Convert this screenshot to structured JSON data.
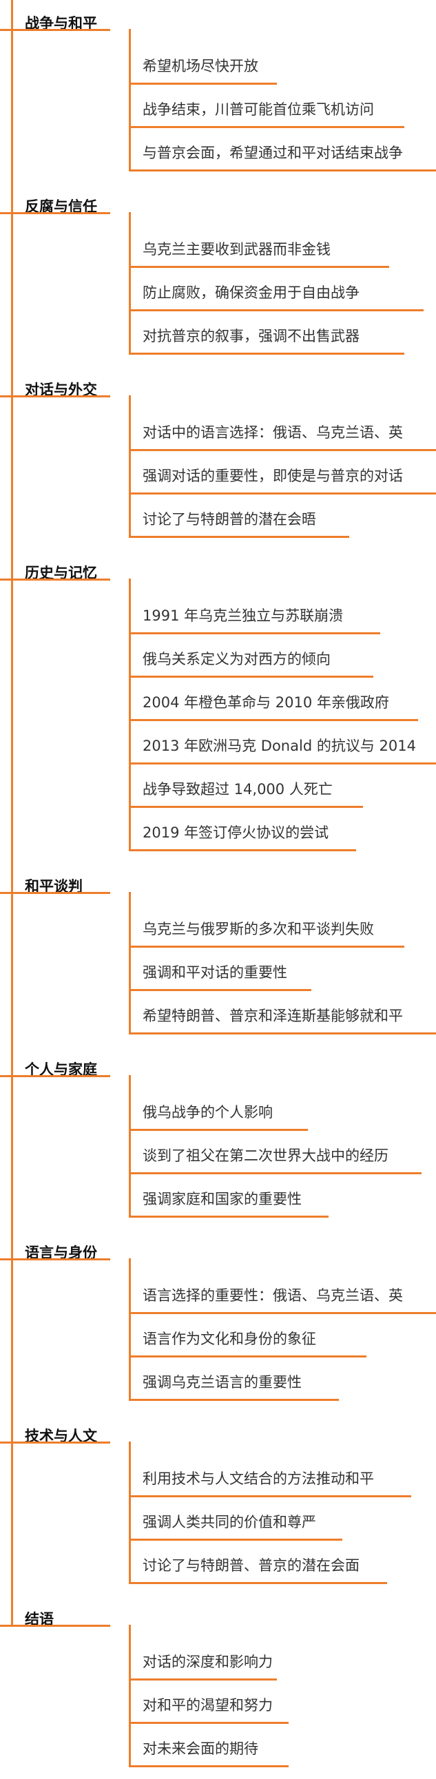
{
  "colors": {
    "branch": "#ee7d2a",
    "section_text": "#111111",
    "item_text": "#333333"
  },
  "sections": [
    {
      "title": "战争与和平",
      "items": [
        "希望机场尽快开放",
        "战争结束，川普可能首位乘飞机访问",
        "与普京会面，希望通过和平对话结束战争"
      ]
    },
    {
      "title": "反腐与信任",
      "items": [
        "乌克兰主要收到武器而非金钱",
        "防止腐败，确保资金用于自由战争",
        "对抗普京的叙事，强调不出售武器"
      ]
    },
    {
      "title": "对话与外交",
      "items": [
        "对话中的语言选择：俄语、乌克兰语、英",
        "强调对话的重要性，即使是与普京的对话",
        "讨论了与特朗普的潜在会晤"
      ]
    },
    {
      "title": "历史与记忆",
      "items": [
        "1991 年乌克兰独立与苏联崩溃",
        "俄乌关系定义为对西方的倾向",
        "2004 年橙色革命与 2010 年亲俄政府",
        "2013 年欧洲马克 Donald 的抗议与 2014",
        "战争导致超过 14,000 人死亡",
        "2019 年签订停火协议的尝试"
      ]
    },
    {
      "title": "和平谈判",
      "items": [
        "乌克兰与俄罗斯的多次和平谈判失败",
        "强调和平对话的重要性",
        "希望特朗普、普京和泽连斯基能够就和平"
      ]
    },
    {
      "title": "个人与家庭",
      "items": [
        "俄乌战争的个人影响",
        "谈到了祖父在第二次世界大战中的经历",
        "强调家庭和国家的重要性"
      ]
    },
    {
      "title": "语言与身份",
      "items": [
        "语言选择的重要性：俄语、乌克兰语、英",
        "语言作为文化和身份的象征",
        "强调乌克兰语言的重要性"
      ]
    },
    {
      "title": "技术与人文",
      "items": [
        "利用技术与人文结合的方法推动和平",
        "强调人类共同的价值和尊严",
        "讨论了与特朗普、普京的潜在会面"
      ]
    },
    {
      "title": "结语",
      "items": [
        "对话的深度和影响力",
        "对和平的渴望和努力",
        "对未来会面的期待"
      ]
    }
  ]
}
